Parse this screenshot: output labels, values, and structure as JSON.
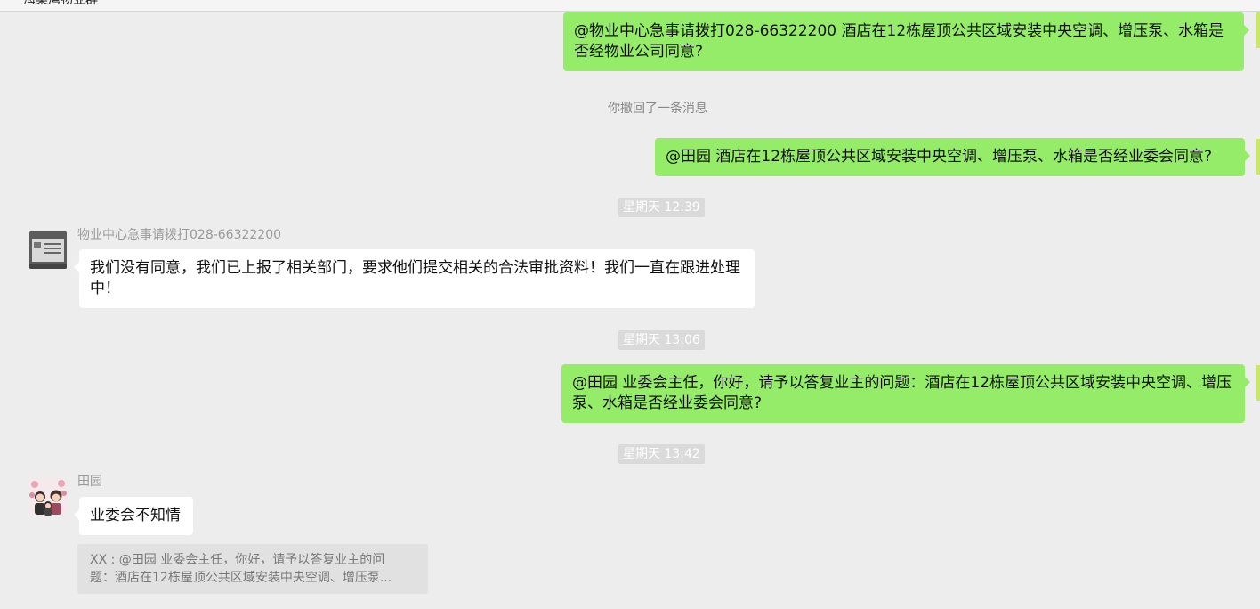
{
  "window": {
    "title": "海棠湾物业群"
  },
  "messages": [
    {
      "side": "me",
      "text": "@物业中心急事请拨打028-66322200 酒店在12栋屋顶公共区域安装中央空调、增压泵、水箱是否经物业公司同意?"
    },
    {
      "side": "system",
      "text": "你撤回了一条消息"
    },
    {
      "side": "me",
      "text": "@田园 酒店在12栋屋顶公共区域安装中央空调、增压泵、水箱是否经业委会同意?"
    },
    {
      "side": "time",
      "text": "星期天 12:39"
    },
    {
      "side": "other",
      "sender": "物业中心急事请拨打028-66322200",
      "avatar_icon": "property-office-sign-avatar",
      "text": "我们没有同意，我们已上报了相关部门，要求他们提交相关的合法审批资料！我们一直在跟进处理中！"
    },
    {
      "side": "time",
      "text": "星期天 13:06"
    },
    {
      "side": "me",
      "text": "@田园 业委会主任，你好，请予以答复业主的问题：酒店在12栋屋顶公共区域安装中央空调、增压泵、水箱是否经业委会同意?"
    },
    {
      "side": "time",
      "text": "星期天 13:42"
    },
    {
      "side": "other",
      "sender": "田园",
      "avatar_icon": "cartoon-family-avatar",
      "text": "业委会不知情",
      "quote": {
        "line1": "XX : @田园 业委会主任，你好，请予以答复业主的问",
        "line2": "题：酒店在12栋屋顶公共区域安装中央空调、增压泵..."
      }
    }
  ],
  "colors": {
    "background": "#ededed",
    "my_bubble": "#95ec69",
    "other_bubble": "#ffffff",
    "time_chip": "#dadada",
    "system_text": "#888888"
  }
}
